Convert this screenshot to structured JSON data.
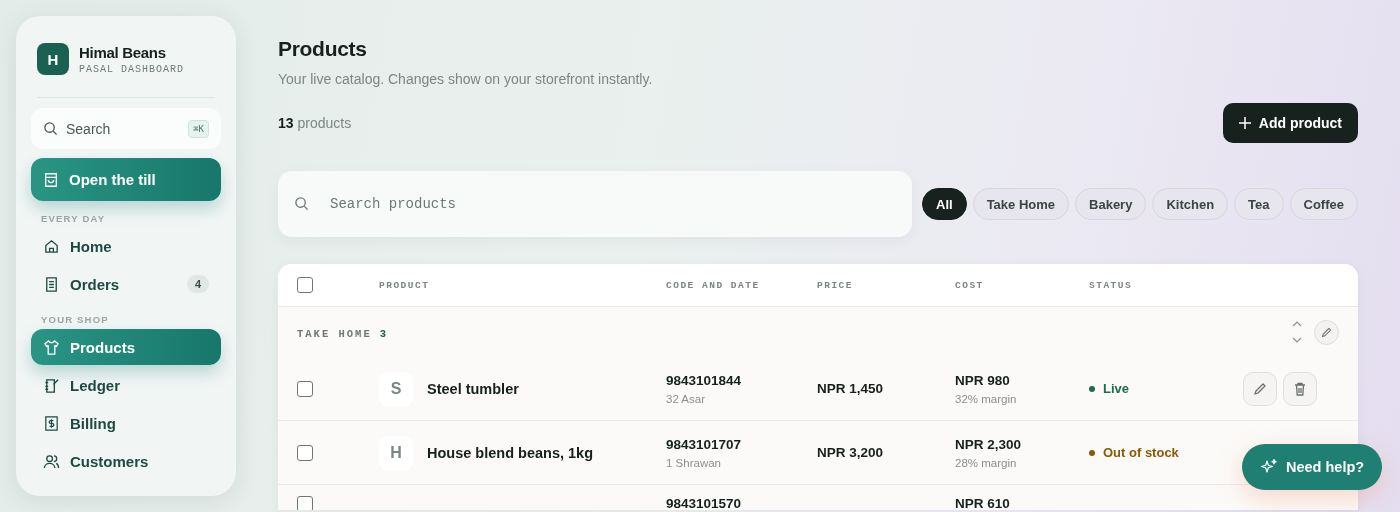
{
  "brand": {
    "logo_letter": "H",
    "name": "Himal Beans",
    "subtitle": "PASAL DASHBOARD"
  },
  "sidebar": {
    "search": {
      "placeholder": "Search",
      "shortcut": "⌘K"
    },
    "primary_action": "Open the till",
    "sections": [
      {
        "heading": "EVERY DAY",
        "items": [
          {
            "label": "Home",
            "selected": false
          },
          {
            "label": "Orders",
            "badge": "4",
            "selected": false
          }
        ]
      },
      {
        "heading": "YOUR SHOP",
        "items": [
          {
            "label": "Products",
            "selected": true
          },
          {
            "label": "Ledger",
            "selected": false
          },
          {
            "label": "Billing",
            "selected": false
          },
          {
            "label": "Customers",
            "selected": false
          }
        ]
      }
    ]
  },
  "page": {
    "title": "Products",
    "subtitle": "Your live catalog. Changes show on your storefront instantly.",
    "count": "13",
    "count_label": "products",
    "add_button": "Add product"
  },
  "search": {
    "placeholder": "Search products"
  },
  "filters": [
    {
      "label": "All",
      "selected": true
    },
    {
      "label": "Take Home",
      "selected": false
    },
    {
      "label": "Bakery",
      "selected": false
    },
    {
      "label": "Kitchen",
      "selected": false
    },
    {
      "label": "Tea",
      "selected": false
    },
    {
      "label": "Coffee",
      "selected": false
    }
  ],
  "table": {
    "select_all": {
      "checked": false
    },
    "columns": [
      "PRODUCT",
      "CODE AND DATE",
      "PRICE",
      "COST",
      "STATUS"
    ],
    "groups": [
      {
        "name": "TAKE HOME",
        "count": "3",
        "rows": [
          {
            "checked": false,
            "initial": "S",
            "name": "Steel tumbler",
            "code": "9843101844",
            "date": "32 Asar",
            "price": "NPR 1,450",
            "cost": "NPR 980",
            "margin": "32% margin",
            "status": {
              "kind": "live",
              "label": "Live"
            }
          },
          {
            "checked": false,
            "initial": "H",
            "name": "House blend beans, 1kg",
            "code": "9843101707",
            "date": "1 Shrawan",
            "price": "NPR 3,200",
            "cost": "NPR 2,300",
            "margin": "28% margin",
            "status": {
              "kind": "out",
              "label": "Out of stock"
            }
          },
          {
            "checked": false,
            "code": "9843101570",
            "cost": "NPR 610"
          }
        ]
      }
    ]
  },
  "help_button": "Need help?"
}
